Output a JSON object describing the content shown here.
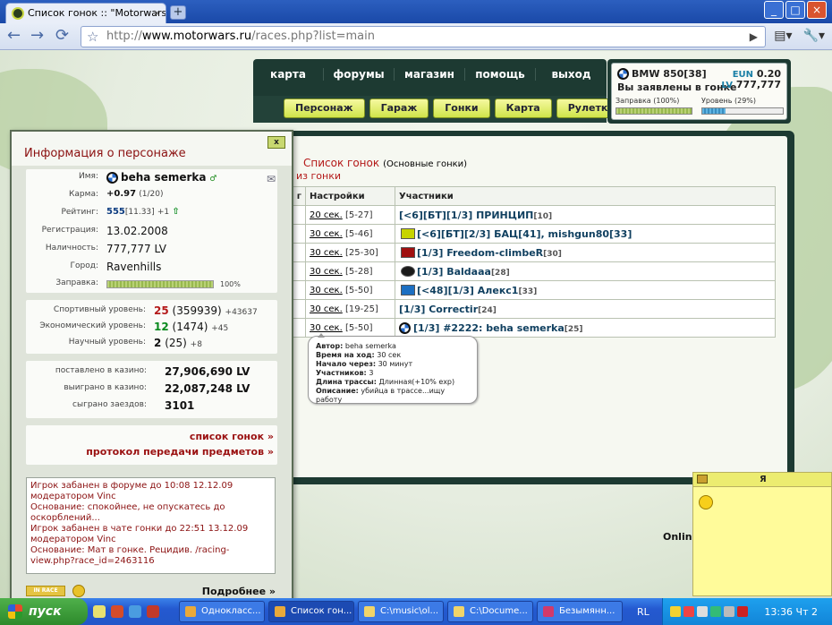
{
  "browser": {
    "tab_title": "Список гонок :: \"Motorwars\"",
    "tab_close": "×",
    "new_tab": "+",
    "win_minimize": "_",
    "win_maximize": "□",
    "win_close": "×",
    "back": "←",
    "forward": "→",
    "reload": "⟳",
    "url_scheme": "http://",
    "url_host": "www.motorwars.ru",
    "url_rest": "/races.php?list=main",
    "go": "▶",
    "page_menu": "▤▾",
    "tools_menu": "🔧▾"
  },
  "site": {
    "menu": [
      "карта",
      "форумы",
      "магазин",
      "помощь",
      "выход"
    ],
    "submenu": [
      "Персонаж",
      "Гараж",
      "Гонки",
      "Карта",
      "Рулетка"
    ],
    "car": {
      "name": "BMW 850[38]",
      "status": "Вы заявлены в гонке",
      "eun_label": "EUN",
      "eun_value": "0.20",
      "lv_label": "LV",
      "lv_value": "777,777",
      "fuel_label": "Заправка",
      "fuel_pct_text": "(100%)",
      "fuel_fraction": 1.0,
      "level_label": "Уровень",
      "level_pct_text": "(29%)",
      "level_fraction": 0.29
    },
    "races": {
      "title": "Список гонок",
      "subtitle": "(Основные гонки)",
      "exit_link": "из гонки",
      "col_num": "г",
      "col_settings": "Настройки",
      "col_participants": "Участники",
      "rows": [
        {
          "time": "20 сек.",
          "range": "[5-27]",
          "participants": "[<6][БТ][1/3] ПРИНЦИП",
          "level": "[10]"
        },
        {
          "time": "30 сек.",
          "range": "[5-46]",
          "participants": "[<6][БТ][2/3] БАЦ[41], mishgun80[33]",
          "level": ""
        },
        {
          "time": "30 сек.",
          "range": "[25-30]",
          "participants": "[1/3] Freedom-climbeR",
          "level": "[30]"
        },
        {
          "time": "30 сек.",
          "range": "[5-28]",
          "participants": "[1/3] Baldaaa",
          "level": "[28]"
        },
        {
          "time": "30 сек.",
          "range": "[5-50]",
          "participants": "[<48][1/3] Алекс1",
          "level": "[33]"
        },
        {
          "time": "30 сек.",
          "range": "[19-25]",
          "participants": "[1/3] Correctir",
          "level": "[24]"
        },
        {
          "time": "30 сек.",
          "range": "[5-50]",
          "participants": "[1/3] #2222: beha semerka",
          "level": "[25]"
        }
      ]
    },
    "tooltip": {
      "author_label": "Автор:",
      "author": "beha semerka",
      "move_label": "Время на ход:",
      "move": "30 сек",
      "start_label": "Начало через:",
      "start": "30 минут",
      "participants_label": "Участников:",
      "participants": "3",
      "length_label": "Длина трассы:",
      "length": "Длинная(+10% exp)",
      "desc_label": "Описание:",
      "desc": "убийца в трассе...ищу работу"
    },
    "online": "Online"
  },
  "character": {
    "title": "Информация о персонаже",
    "close": "x",
    "name_label": "Имя:",
    "name": "beha semerka",
    "karma_label": "Карма:",
    "karma": "+0.97",
    "karma_extra": "(1/20)",
    "rating_label": "Рейтинг:",
    "rating": "555",
    "rating_extra": "[11.33]",
    "rating_delta": "+1",
    "reg_label": "Регистрация:",
    "reg": "13.02.2008",
    "cash_label": "Наличность:",
    "cash": "777,777 LV",
    "city_label": "Город:",
    "city": "Ravenhills",
    "fuel_label": "Заправка:",
    "fuel_pct": "100%",
    "fuel_fraction": 1.0,
    "sport_label": "Спортивный уровень:",
    "sport": "25",
    "sport_xp": "(359939)",
    "sport_delta": "+43637",
    "econ_label": "Экономический уровень:",
    "econ": "12",
    "econ_xp": "(1474)",
    "econ_delta": "+45",
    "sci_label": "Научный уровень:",
    "sci": "2",
    "sci_xp": "(25)",
    "sci_delta": "+8",
    "casino_bet_label": "поставлено в казино:",
    "casino_bet": "27,906,690 LV",
    "casino_win_label": "выиграно в казино:",
    "casino_win": "22,087,248 LV",
    "races_label": "сыграно заездов:",
    "races": "3101",
    "link_races": "список гонок »",
    "link_transfer": "протокол передачи предметов »",
    "ban": [
      "Игрок забанен в форуме до 10:08 12.12.09",
      "модератором Vinc",
      "Основание: спокойнее, не опускатесь до оскорблений...",
      "Игрок забанен в чате гонки до 22:51 13.12.09",
      "модератором Vinc",
      "Основание: Мат в гонке. Рецидив. /racing-view.php?race_id=2463116"
    ],
    "in_race": "IN RACE",
    "more": "Подробнее »"
  },
  "note": {
    "title": "Я"
  },
  "taskbar": {
    "start": "пуск",
    "tasks": [
      "Однокласс...",
      "Список гон...",
      "C:\\music\\ol...",
      "C:\\Docume...",
      "Безымянн..."
    ],
    "lang": "RL",
    "clock": "13:36 Чт 2"
  },
  "colors": {
    "accent_red": "#b41919",
    "menu_bg": "#1d3a32",
    "button_yellow": "#cfe44a"
  }
}
